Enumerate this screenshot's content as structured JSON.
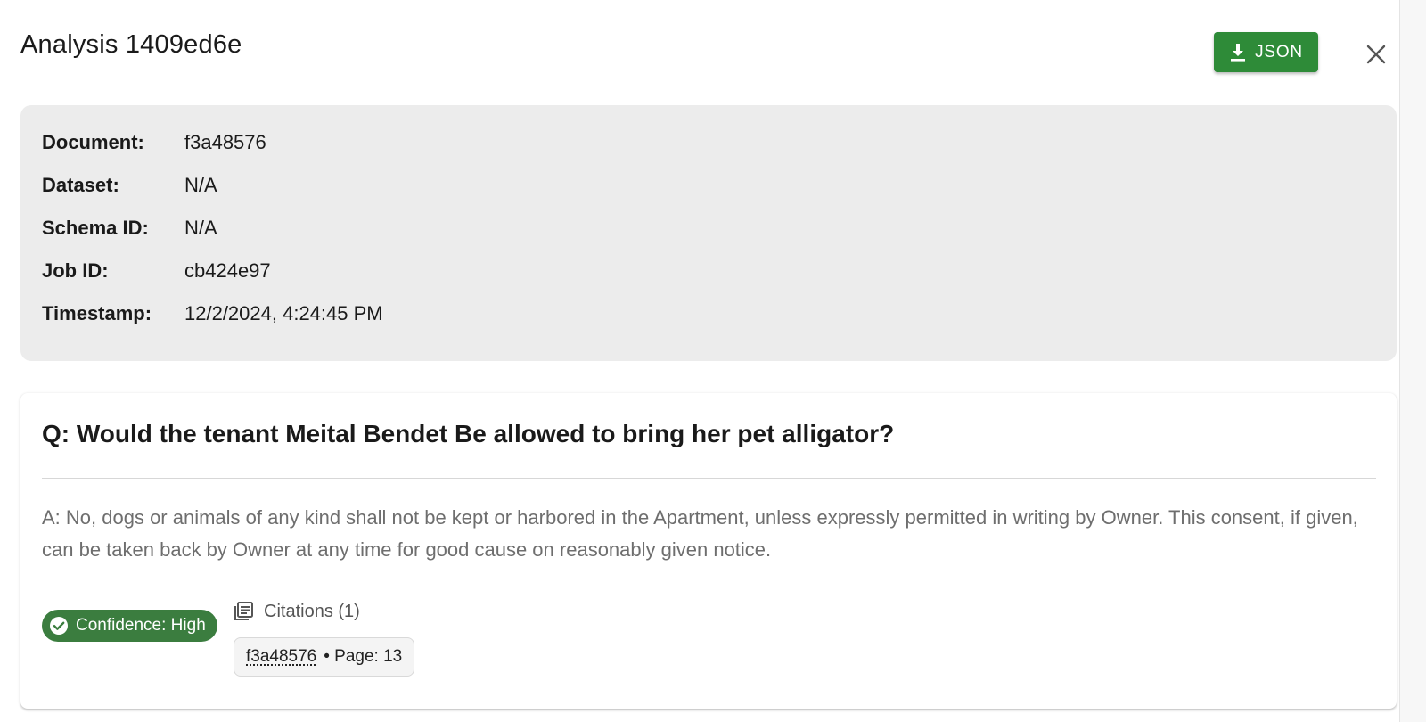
{
  "header": {
    "title": "Analysis 1409ed6e",
    "json_button_label": "JSON",
    "download_icon": "download-icon",
    "close_icon": "close-icon"
  },
  "metadata": {
    "rows": [
      {
        "label": "Document:",
        "value": "f3a48576"
      },
      {
        "label": "Dataset:",
        "value": "N/A"
      },
      {
        "label": "Schema ID:",
        "value": "N/A"
      },
      {
        "label": "Job ID:",
        "value": "cb424e97"
      },
      {
        "label": "Timestamp:",
        "value": "12/2/2024, 4:24:45 PM"
      }
    ]
  },
  "qa": {
    "question": "Q: Would the tenant Meital Bendet Be allowed to bring her pet alligator?",
    "answer": "A: No, dogs or animals of any kind shall not be kept or harbored in the Apartment, unless expressly permitted in writing by Owner. This consent, if given, can be taken back by Owner at any time for good cause on reasonably given notice.",
    "confidence_label": "Confidence: High",
    "confidence_icon": "check-circle-icon",
    "citations_label": "Citations (1)",
    "citations_icon": "library-books-icon",
    "citations": [
      {
        "document": "f3a48576",
        "page": "• Page: 13"
      }
    ]
  },
  "colors": {
    "json_button": "#2e8b38",
    "confidence_badge": "#3b7d3f",
    "metadata_panel": "#ececec"
  }
}
